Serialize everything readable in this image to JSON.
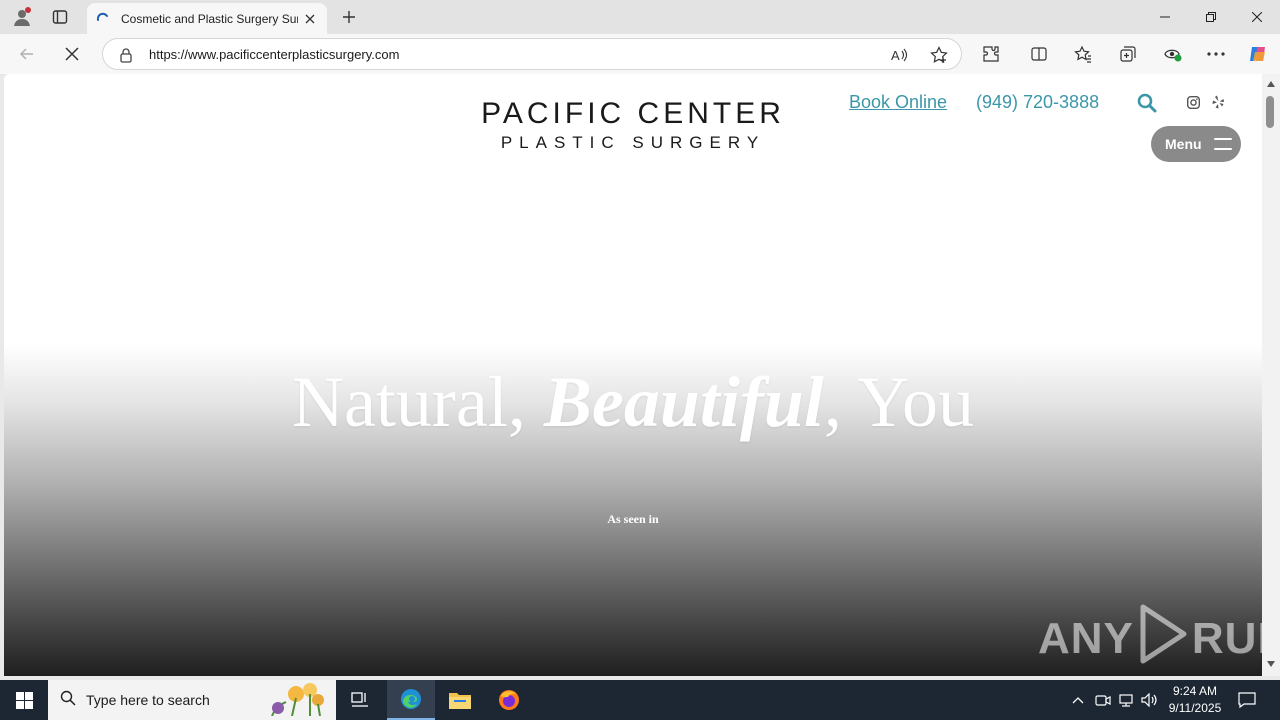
{
  "browser": {
    "tab": {
      "title": "Cosmetic and Plastic Surgery Surgeon"
    },
    "address": {
      "url": "https://www.pacificcenterplasticsurgery.com"
    }
  },
  "site": {
    "logo": {
      "line1": "PACIFIC CENTER",
      "line2": "PLASTIC SURGERY"
    },
    "header": {
      "book_online": "Book Online",
      "phone": "(949) 720-3888",
      "menu_label": "Menu"
    },
    "hero": {
      "headline_part1": "Natural, ",
      "headline_emphasis": "Beautiful",
      "headline_part2": ", You",
      "as_seen_in": "As seen in"
    },
    "watermark": {
      "left": "ANY",
      "right": "RUN"
    }
  },
  "taskbar": {
    "search_placeholder": "Type here to search",
    "time": "9:24 AM",
    "date": "9/11/2025"
  },
  "colors": {
    "accent": "#3b97a8",
    "menu_button": "#8a8a8a",
    "taskbar": "#1d2633"
  }
}
